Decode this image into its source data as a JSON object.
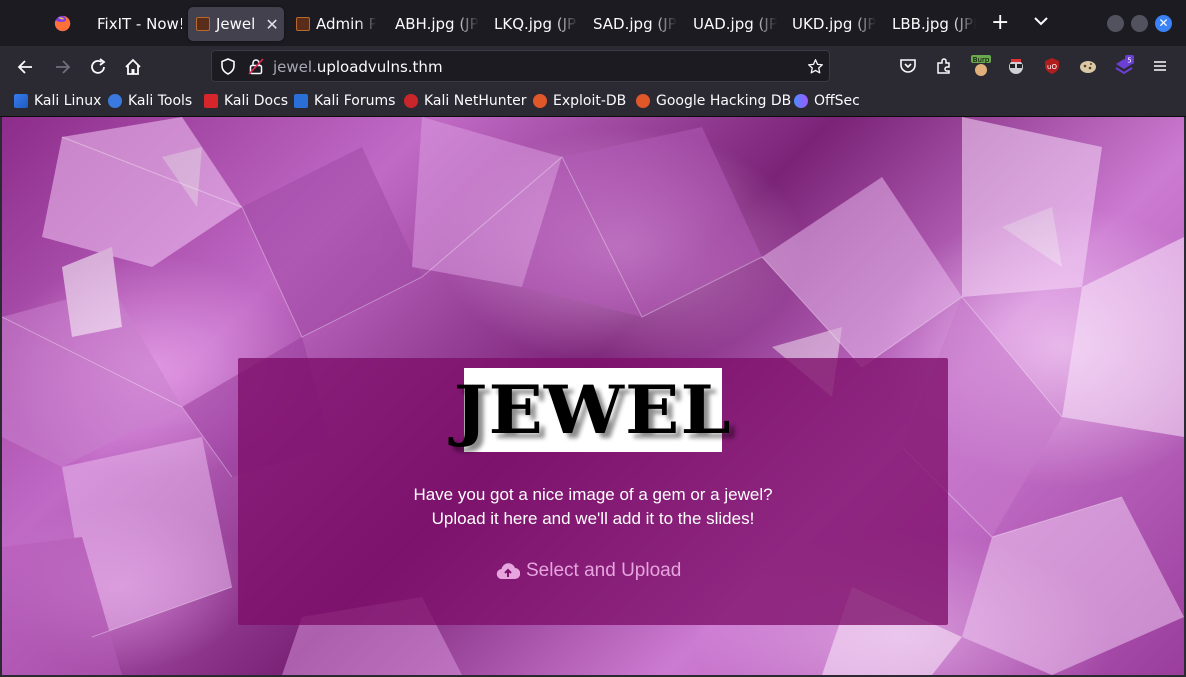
{
  "browser": {
    "tabs": [
      {
        "label": "FixIT - Now!"
      },
      {
        "label": "Jewel",
        "active": true
      },
      {
        "label": "Admin P"
      },
      {
        "label": "ABH.jpg (JPE"
      },
      {
        "label": "LKQ.jpg (JPE"
      },
      {
        "label": "SAD.jpg (JPE"
      },
      {
        "label": "UAD.jpg (JPE"
      },
      {
        "label": "UKD.jpg (JPE"
      },
      {
        "label": "LBB.jpg (JPE"
      }
    ],
    "url": {
      "host_prefix": "jewel.",
      "domain": "uploadvulns.thm"
    },
    "extension_badge": "5",
    "burp_label": "Burp",
    "bookmarks": [
      {
        "label": "Kali Linux",
        "icon": "kali-dragon-icon"
      },
      {
        "label": "Kali Tools",
        "icon": "kali-tools-icon"
      },
      {
        "label": "Kali Docs",
        "icon": "kali-docs-icon"
      },
      {
        "label": "Kali Forums",
        "icon": "kali-forums-icon"
      },
      {
        "label": "Kali NetHunter",
        "icon": "nethunter-icon"
      },
      {
        "label": "Exploit-DB",
        "icon": "exploit-db-icon"
      },
      {
        "label": "Google Hacking DB",
        "icon": "ghdb-icon"
      },
      {
        "label": "OffSec",
        "icon": "offsec-icon"
      }
    ]
  },
  "page": {
    "logo_text": "JEWEL",
    "message_line1": "Have you got a nice image of a gem or a jewel?",
    "message_line2": "Upload it here and we'll add it to the slides!",
    "upload_label": "Select and Upload",
    "colors": {
      "panel": "#7d0e69",
      "upload_text": "#e6a5df",
      "accent": "#3b82f6"
    }
  }
}
